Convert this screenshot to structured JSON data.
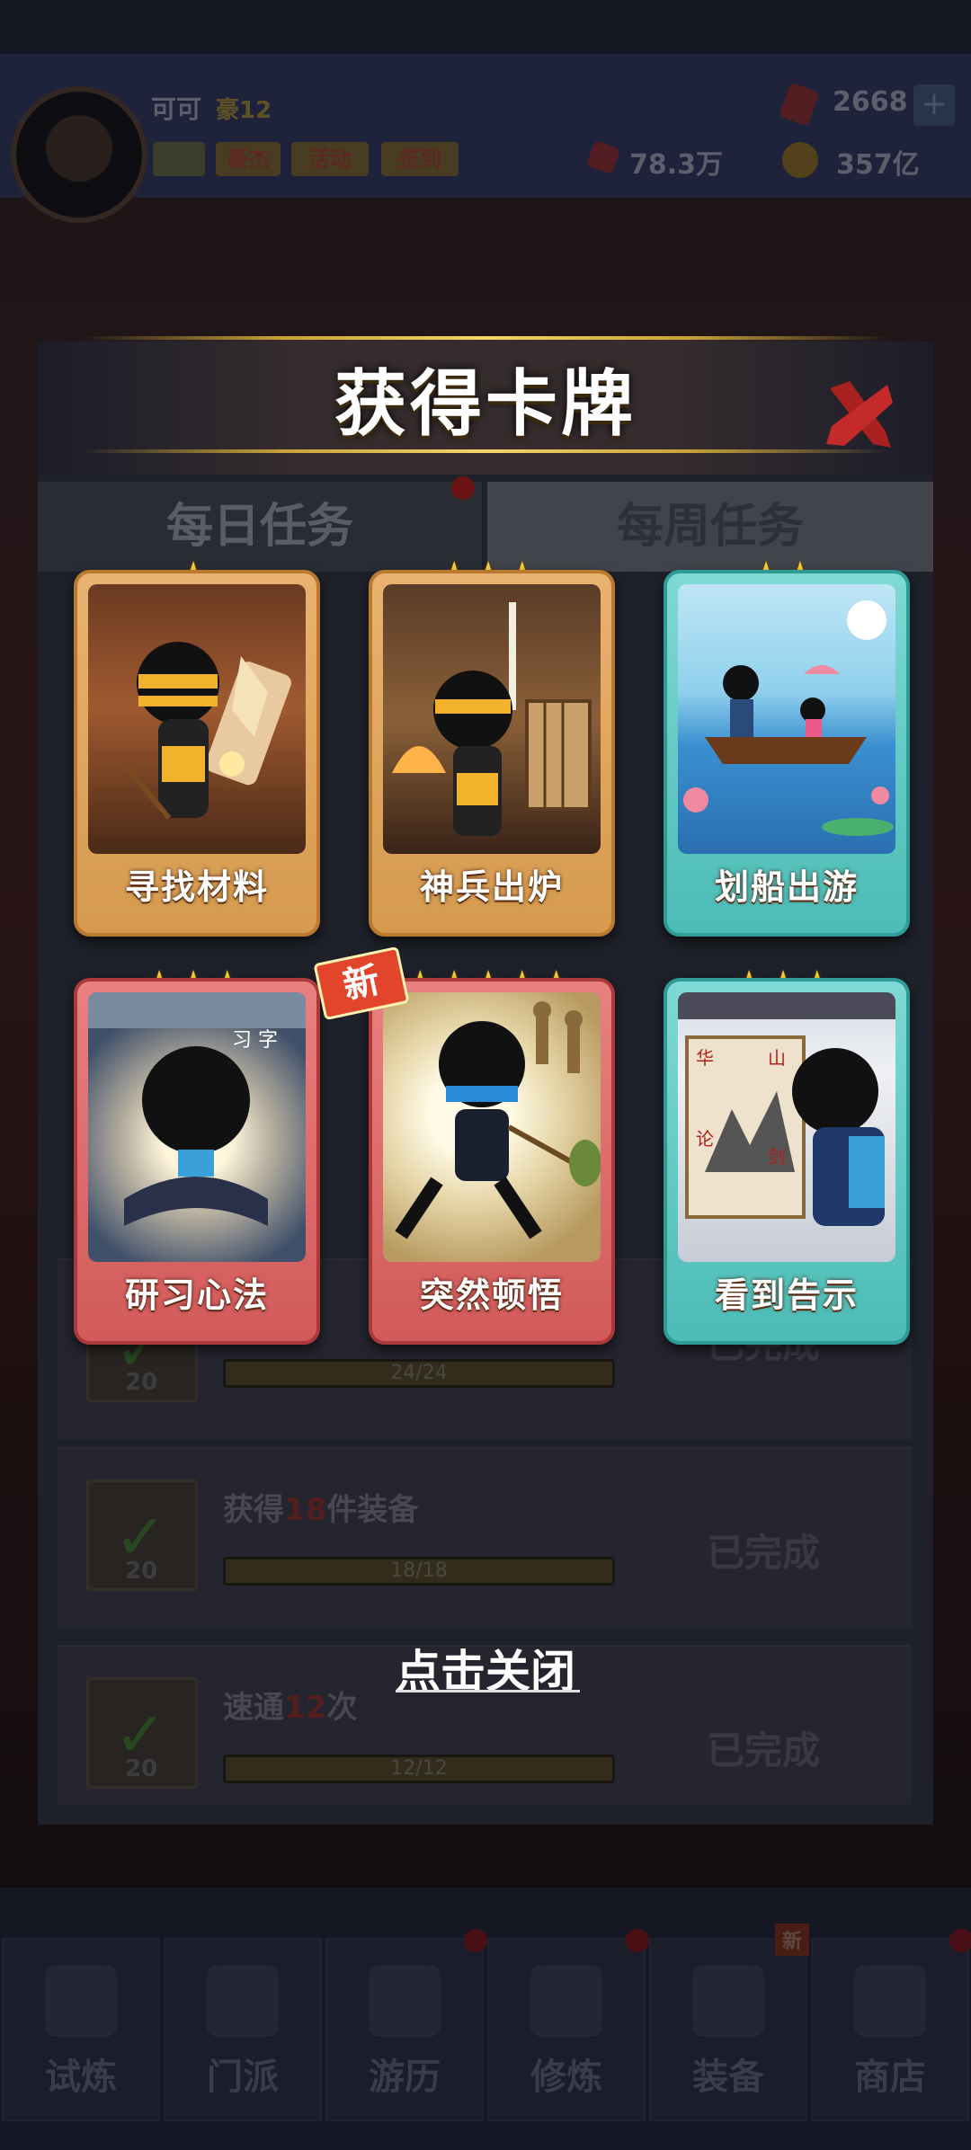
{
  "player": {
    "name": "可可",
    "vip_level": "豪12",
    "badges": [
      "豪杰",
      "活动",
      "签到"
    ],
    "gems": "2668",
    "power": "78.3万",
    "coins": "357亿"
  },
  "dialog": {
    "title": "获得卡牌",
    "close_hint": "点击关闭",
    "new_badge": "新",
    "cards": [
      {
        "name": "寻找材料",
        "stars": 1,
        "frame": "orange"
      },
      {
        "name": "神兵出炉",
        "stars": 3,
        "frame": "orange"
      },
      {
        "name": "划船出游",
        "stars": 2,
        "frame": "teal"
      },
      {
        "name": "研习心法",
        "stars": 3,
        "frame": "red"
      },
      {
        "name": "突然顿悟",
        "stars": 5,
        "frame": "red",
        "is_new": true
      },
      {
        "name": "看到告示",
        "stars": 3,
        "frame": "teal"
      }
    ]
  },
  "background": {
    "tabs": [
      "每日任务",
      "每周任务"
    ],
    "tasks": [
      {
        "title_prefix": "获得",
        "highlight": "18",
        "title_suffix": "件装备",
        "progress": "18/18",
        "status": "已完成",
        "reward": "20"
      },
      {
        "title_prefix": "速通",
        "highlight": "12",
        "title_suffix": "次",
        "progress": "12/12",
        "status": "已完成",
        "reward": "20"
      }
    ],
    "partial_task": {
      "progress": "24/24",
      "status": "已完成",
      "reward": "20"
    },
    "partial_status_top": "已完成"
  },
  "nav": {
    "items": [
      "试炼",
      "门派",
      "游历",
      "修炼",
      "装备",
      "商店"
    ],
    "new_tag": "新"
  },
  "colors": {
    "star": "#ffd43a",
    "card_orange": "#e0a25a",
    "card_teal": "#5cc8c2",
    "card_red": "#dc6666",
    "title_gold": "#f5d56a"
  }
}
